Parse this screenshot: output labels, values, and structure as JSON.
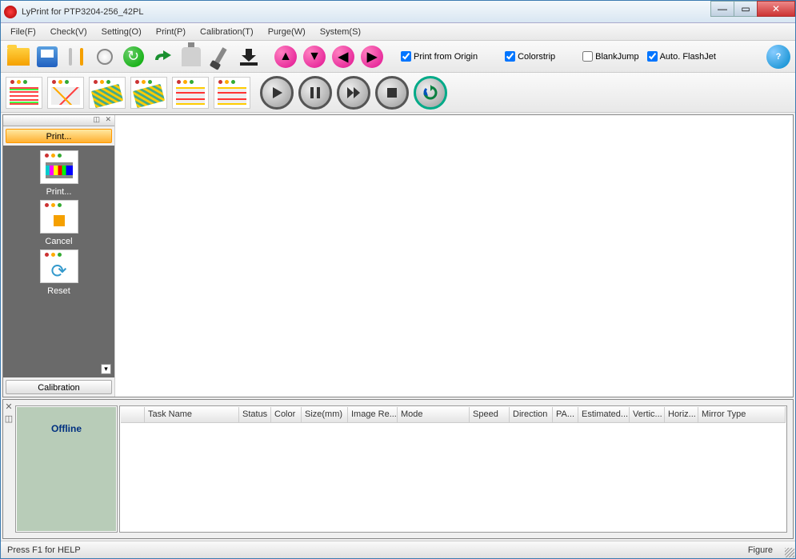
{
  "window": {
    "title": "LyPrint for PTP3204-256_42PL"
  },
  "menu": {
    "file": "File(F)",
    "check": "Check(V)",
    "setting": "Setting(O)",
    "print": "Print(P)",
    "calibration": "Calibration(T)",
    "purge": "Purge(W)",
    "system": "System(S)"
  },
  "checkboxes": {
    "print_from_origin": {
      "label": "Print from Origin",
      "checked": true
    },
    "colorstrip": {
      "label": "Colorstrip",
      "checked": true
    },
    "blankjump": {
      "label": "BlankJump",
      "checked": false
    },
    "auto_flashjet": {
      "label": "Auto. FlashJet",
      "checked": true
    }
  },
  "sidebar": {
    "print_header": "Print...",
    "items": {
      "print": "Print...",
      "cancel": "Cancel",
      "reset": "Reset"
    },
    "calibration_header": "Calibration"
  },
  "status": {
    "text": "Offline"
  },
  "table": {
    "columns": [
      "",
      "Task Name",
      "Status",
      "Color",
      "Size(mm)",
      "Image Re...",
      "Mode",
      "Speed",
      "Direction",
      "PA...",
      "Estimated...",
      "Vertic...",
      "Horiz...",
      "Mirror Type"
    ]
  },
  "statusbar": {
    "left": "Press F1 for HELP",
    "right": "Figure"
  }
}
